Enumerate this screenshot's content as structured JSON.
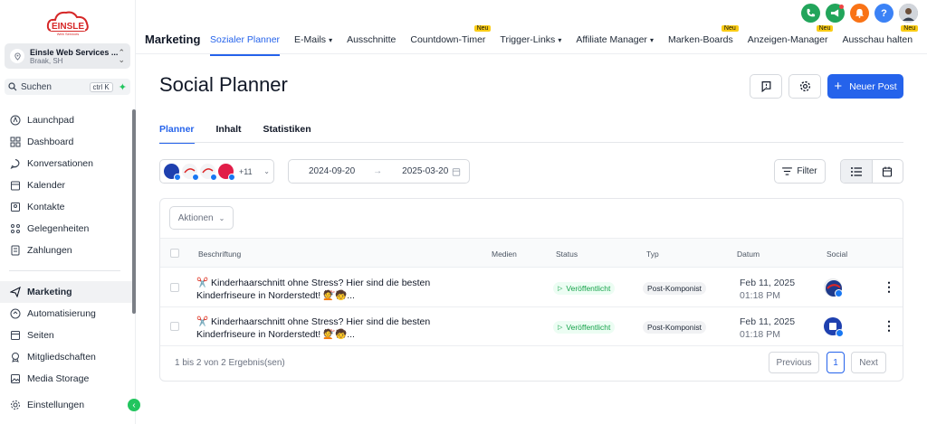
{
  "sidebar": {
    "logo_text": "EINSLE",
    "logo_sub": "Web Services",
    "account_name": "Einsle Web Services ...",
    "account_location": "Braak, SH",
    "search_label": "Suchen",
    "search_shortcut": "ctrl K",
    "items": [
      {
        "label": "Launchpad",
        "icon": "launchpad-icon"
      },
      {
        "label": "Dashboard",
        "icon": "dashboard-icon"
      },
      {
        "label": "Konversationen",
        "icon": "chat-icon"
      },
      {
        "label": "Kalender",
        "icon": "calendar-icon"
      },
      {
        "label": "Kontakte",
        "icon": "contacts-icon"
      },
      {
        "label": "Gelegenheiten",
        "icon": "opportunities-icon"
      },
      {
        "label": "Zahlungen",
        "icon": "payments-icon"
      }
    ],
    "items2": [
      {
        "label": "Marketing",
        "icon": "send-icon"
      },
      {
        "label": "Automatisierung",
        "icon": "automation-icon"
      },
      {
        "label": "Seiten",
        "icon": "pages-icon"
      },
      {
        "label": "Mitgliedschaften",
        "icon": "membership-icon"
      },
      {
        "label": "Media Storage",
        "icon": "media-icon"
      }
    ],
    "settings_label": "Einstellungen"
  },
  "topnav": {
    "brand": "Marketing",
    "tabs": [
      {
        "label": "Sozialer Planner",
        "active": true
      },
      {
        "label": "E-Mails",
        "caret": true
      },
      {
        "label": "Ausschnitte"
      },
      {
        "label": "Countdown-Timer",
        "badge": "Neu"
      },
      {
        "label": "Trigger-Links",
        "caret": true
      },
      {
        "label": "Affiliate Manager",
        "caret": true
      },
      {
        "label": "Marken-Boards",
        "badge": "Neu"
      },
      {
        "label": "Anzeigen-Manager",
        "badge": "Neu"
      },
      {
        "label": "Ausschau halten",
        "badge": "Neu"
      }
    ],
    "help_label": "?"
  },
  "main": {
    "title": "Social Planner",
    "new_post_label": "Neuer Post",
    "subtabs": [
      "Planner",
      "Inhalt",
      "Statistiken"
    ],
    "accounts_more": "+11",
    "date_from": "2024-09-20",
    "date_to": "2025-03-20",
    "filter_label": "Filter",
    "actions_label": "Aktionen",
    "columns": {
      "caption": "Beschriftung",
      "media": "Medien",
      "status": "Status",
      "type": "Typ",
      "date": "Datum",
      "social": "Social"
    },
    "rows": [
      {
        "caption_line1": "✂️ Kinderhaarschnitt ohne Stress? Hier sind die besten",
        "caption_line2": "Kinderfriseure in Norderstedt! 💇🧒...",
        "status": "Veröffentlicht",
        "type": "Post-Komponist",
        "date": "Feb 11, 2025",
        "time": "01:18 PM"
      },
      {
        "caption_line1": "✂️ Kinderhaarschnitt ohne Stress? Hier sind die besten",
        "caption_line2": "Kinderfriseure in Norderstedt! 💇🧒...",
        "status": "Veröffentlicht",
        "type": "Post-Komponist",
        "date": "Feb 11, 2025",
        "time": "01:18 PM"
      }
    ],
    "results_text": "1 bis 2 von 2 Ergebnis(sen)",
    "prev_label": "Previous",
    "page_current": "1",
    "next_label": "Next"
  },
  "colors": {
    "accent": "#2563eb",
    "success": "#16a34a",
    "badge": "#facc15"
  }
}
